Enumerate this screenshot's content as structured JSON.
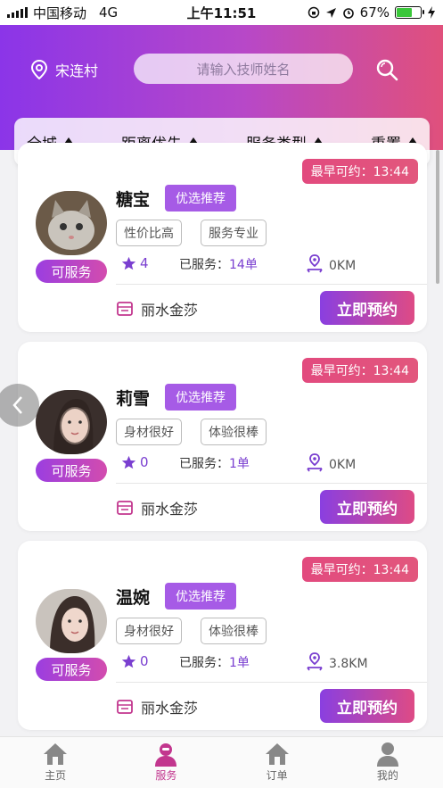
{
  "status_bar": {
    "carrier": "中国移动",
    "network": "4G",
    "time": "上午11:51",
    "battery_percent": "67%",
    "battery_level": 0.67
  },
  "header": {
    "location": "宋连村",
    "search_placeholder": "请输入技师姓名"
  },
  "filters": [
    "全城",
    "距离优先",
    "服务类型",
    "重置"
  ],
  "cards": [
    {
      "earliest_label": "最早可约：13:44",
      "name": "糖宝",
      "recommend_tag": "优选推荐",
      "tags": [
        "性价比高",
        "服务专业"
      ],
      "status": "可服务",
      "rating": "4",
      "served_label": "已服务：",
      "served_count": "14单",
      "distance": "0KM",
      "shop": "丽水金莎",
      "book_label": "立即预约"
    },
    {
      "earliest_label": "最早可约：13:44",
      "name": "莉雪",
      "recommend_tag": "优选推荐",
      "tags": [
        "身材很好",
        "体验很棒"
      ],
      "status": "可服务",
      "rating": "0",
      "served_label": "已服务：",
      "served_count": "1单",
      "distance": "0KM",
      "shop": "丽水金莎",
      "book_label": "立即预约"
    },
    {
      "earliest_label": "最早可约：13:44",
      "name": "温婉",
      "recommend_tag": "优选推荐",
      "tags": [
        "身材很好",
        "体验很棒"
      ],
      "status": "可服务",
      "rating": "0",
      "served_label": "已服务：",
      "served_count": "1单",
      "distance": "3.8KM",
      "shop": "丽水金莎",
      "book_label": "立即预约"
    }
  ],
  "tabbar": [
    {
      "label": "主页",
      "icon": "home-icon",
      "active": false
    },
    {
      "label": "服务",
      "icon": "technician-icon",
      "active": true
    },
    {
      "label": "订单",
      "icon": "order-icon",
      "active": false
    },
    {
      "label": "我的",
      "icon": "profile-icon",
      "active": false
    }
  ],
  "colors": {
    "brand_purple": "#8b35e8",
    "brand_pink": "#e0507c",
    "accent_purple": "#7a3fd0"
  }
}
